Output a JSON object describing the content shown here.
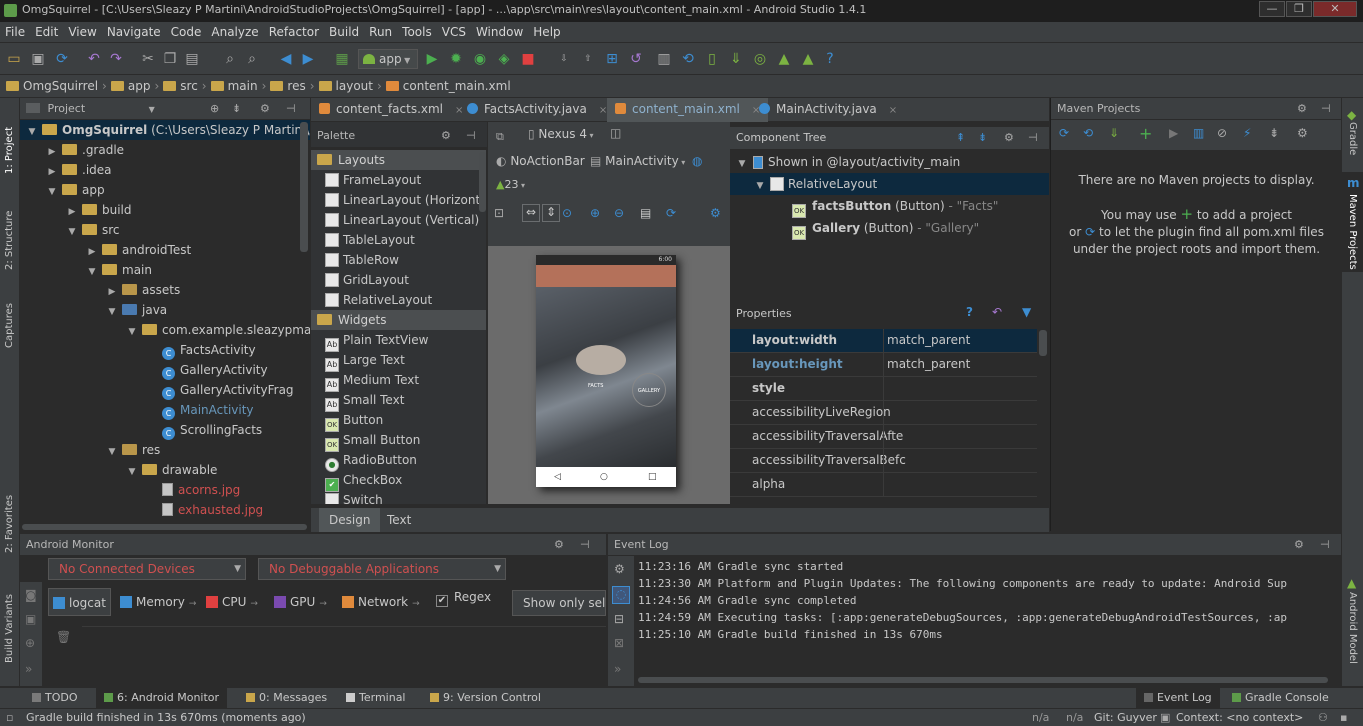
{
  "window": {
    "title": "OmgSquirrel - [C:\\Users\\Sleazy P Martini\\AndroidStudioProjects\\OmgSquirrel] - [app] - ...\\app\\src\\main\\res\\layout\\content_main.xml - Android Studio 1.4.1",
    "minimize": "—",
    "restore": "❐",
    "close": "✕"
  },
  "menu": [
    "File",
    "Edit",
    "View",
    "Navigate",
    "Code",
    "Analyze",
    "Refactor",
    "Build",
    "Run",
    "Tools",
    "VCS",
    "Window",
    "Help"
  ],
  "toolbar": {
    "run_config": "app"
  },
  "breadcrumbs": [
    "OmgSquirrel",
    "app",
    "src",
    "main",
    "res",
    "layout",
    "content_main.xml"
  ],
  "left_strip": {
    "project": "1: Project",
    "structure": "2: Structure",
    "captures": "Captures",
    "favorites": "2: Favorites",
    "build_variants": "Build Variants"
  },
  "right_strip": {
    "gradle": "Gradle",
    "maven": "Maven Projects",
    "android_model": "Android Model"
  },
  "project_panel": {
    "title": "Project"
  },
  "tree": [
    {
      "label": "OmgSquirrel",
      "extra": " (C:\\Users\\Sleazy P Martini\\Anc",
      "depth": 0,
      "open": true,
      "kind": "module",
      "sel": true
    },
    {
      "label": ".gradle",
      "depth": 1,
      "open": false,
      "kind": "folder"
    },
    {
      "label": ".idea",
      "depth": 1,
      "open": false,
      "kind": "folder"
    },
    {
      "label": "app",
      "depth": 1,
      "open": true,
      "kind": "folder"
    },
    {
      "label": "build",
      "depth": 2,
      "open": false,
      "kind": "folder"
    },
    {
      "label": "src",
      "depth": 2,
      "open": true,
      "kind": "folder"
    },
    {
      "label": "androidTest",
      "depth": 3,
      "open": false,
      "kind": "folder"
    },
    {
      "label": "main",
      "depth": 3,
      "open": true,
      "kind": "folder"
    },
    {
      "label": "assets",
      "depth": 4,
      "open": false,
      "kind": "folder"
    },
    {
      "label": "java",
      "depth": 4,
      "open": true,
      "kind": "folder"
    },
    {
      "label": "com.example.sleazypmart",
      "depth": 5,
      "open": true,
      "kind": "folder"
    },
    {
      "label": "FactsActivity",
      "depth": 6,
      "kind": "class"
    },
    {
      "label": "GalleryActivity",
      "depth": 6,
      "kind": "class"
    },
    {
      "label": "GalleryActivityFrag",
      "depth": 6,
      "kind": "class"
    },
    {
      "label": "MainActivity",
      "depth": 6,
      "kind": "class",
      "blue": true
    },
    {
      "label": "ScrollingFacts",
      "depth": 6,
      "kind": "class"
    },
    {
      "label": "res",
      "depth": 4,
      "open": true,
      "kind": "folder"
    },
    {
      "label": "drawable",
      "depth": 5,
      "open": true,
      "kind": "folder"
    },
    {
      "label": "acorns.jpg",
      "depth": 6,
      "kind": "image",
      "red": true
    },
    {
      "label": "exhausted.jpg",
      "depth": 6,
      "kind": "image",
      "red": true
    }
  ],
  "editor_tabs": [
    {
      "label": "content_facts.xml",
      "active": false
    },
    {
      "label": "FactsActivity.java",
      "active": false
    },
    {
      "label": "content_main.xml",
      "active": true
    },
    {
      "label": "MainActivity.java",
      "active": false
    }
  ],
  "palette": {
    "title": "Palette",
    "groups": [
      {
        "name": "Layouts",
        "items": [
          {
            "label": "FrameLayout",
            "icon": ""
          },
          {
            "label": "LinearLayout (Horizontal)",
            "icon": ""
          },
          {
            "label": "LinearLayout (Vertical)",
            "icon": ""
          },
          {
            "label": "TableLayout",
            "icon": ""
          },
          {
            "label": "TableRow",
            "icon": ""
          },
          {
            "label": "GridLayout",
            "icon": ""
          },
          {
            "label": "RelativeLayout",
            "icon": ""
          }
        ]
      },
      {
        "name": "Widgets",
        "items": [
          {
            "label": "Plain TextView",
            "icon": "Ab"
          },
          {
            "label": "Large Text",
            "icon": "Ab"
          },
          {
            "label": "Medium Text",
            "icon": "Ab"
          },
          {
            "label": "Small Text",
            "icon": "Ab"
          },
          {
            "label": "Button",
            "icon": "OK"
          },
          {
            "label": "Small Button",
            "icon": "OK"
          },
          {
            "label": "RadioButton",
            "icon": "●"
          },
          {
            "label": "CheckBox",
            "icon": "✔"
          },
          {
            "label": "Switch",
            "icon": ""
          }
        ]
      }
    ]
  },
  "designer": {
    "device": "Nexus 4",
    "theme": "NoActionBar",
    "activity": "MainActivity",
    "api": "23",
    "phone_facts": "FACTS",
    "phone_gallery": "GALLERY",
    "status_time": "6:00"
  },
  "design_tabs": [
    "Design",
    "Text"
  ],
  "component_tree": {
    "title": "Component Tree",
    "root": "Shown in @layout/activity_main",
    "layout": "RelativeLayout",
    "children": [
      {
        "name": "factsButton",
        "type": " (Button)",
        "value": " - \"Facts\""
      },
      {
        "name": "Gallery",
        "type": " (Button)",
        "value": " - \"Gallery\""
      }
    ]
  },
  "properties": {
    "title": "Properties",
    "rows": [
      {
        "key": "layout:width",
        "value": "match_parent",
        "hl": true,
        "bold": true
      },
      {
        "key": "layout:height",
        "value": "match_parent",
        "blue": true,
        "bold": true
      },
      {
        "key": "style",
        "value": "",
        "bold": true
      },
      {
        "key": "accessibilityLiveRegion",
        "value": ""
      },
      {
        "key": "accessibilityTraversalAfte",
        "value": ""
      },
      {
        "key": "accessibilityTraversalBefc",
        "value": ""
      },
      {
        "key": "alpha",
        "value": ""
      }
    ]
  },
  "maven": {
    "title": "Maven Projects",
    "line1": "There are no Maven projects to display.",
    "line2a": "You may use",
    "line2b": "to add a project",
    "line3a": "or",
    "line3b": "to let the plugin find all pom.xml files",
    "line4": "under the project roots and import them."
  },
  "monitor": {
    "title": "Android Monitor",
    "devices": "No Connected Devices",
    "apps": "No Debuggable Applications",
    "tabs": [
      "logcat",
      "Memory",
      "CPU",
      "GPU",
      "Network"
    ],
    "regex": "Regex",
    "filter": "Show only sele"
  },
  "event_log": {
    "title": "Event Log",
    "lines": [
      "11:23:16 AM Gradle sync started",
      "11:23:30 AM Platform and Plugin Updates: The following components are ready to update: Android Sup",
      "11:24:56 AM Gradle sync completed",
      "11:24:59 AM Executing tasks: [:app:generateDebugSources, :app:generateDebugAndroidTestSources, :ap",
      "11:25:10 AM Gradle build finished in 13s 670ms"
    ]
  },
  "tool_windows": [
    {
      "label": "TODO",
      "color": "#7a7a7a"
    },
    {
      "label": "6: Android Monitor",
      "color": "#5d9b4a",
      "active": true
    },
    {
      "label": "0: Messages",
      "color": "#c9a64b"
    },
    {
      "label": "Terminal",
      "color": "#cccccc"
    },
    {
      "label": "9: Version Control",
      "color": "#c9a64b"
    }
  ],
  "tool_windows_right": [
    {
      "label": "Event Log"
    },
    {
      "label": "Gradle Console"
    }
  ],
  "status": {
    "message": "Gradle build finished in 13s 670ms (moments ago)",
    "na1": "n/a",
    "na2": "n/a",
    "git": "Git: Guyver",
    "context": "Context: <no context>"
  }
}
